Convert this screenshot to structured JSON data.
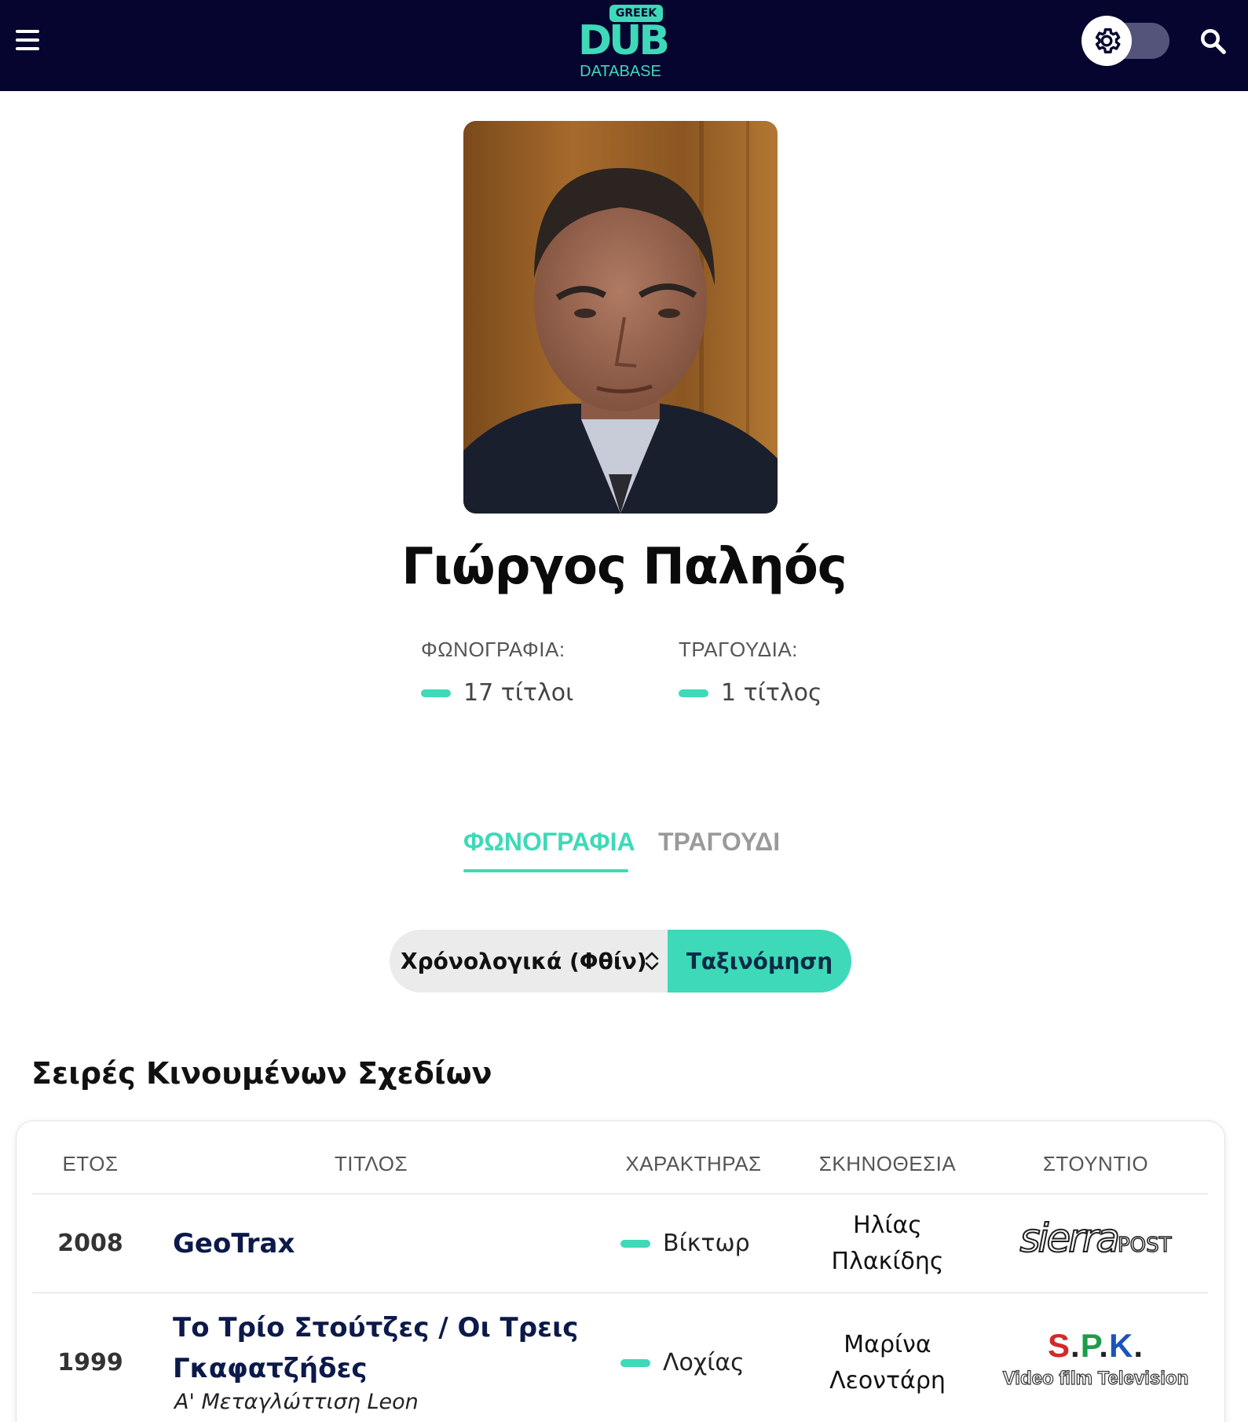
{
  "header": {
    "logo_top": "GREEK",
    "logo_main": "DUB",
    "logo_bottom": "DATABASE",
    "menu_icon": "hamburger-menu-icon",
    "settings_icon": "gear-icon",
    "search_icon": "search-icon",
    "background": "#050530",
    "accent": "#3ed9b8"
  },
  "profile": {
    "name": "Γιώργος Παληός",
    "stats": [
      {
        "label": "ΦΩΝΟΓΡΑΦΙΑ:",
        "value": "17 τίτλοι"
      },
      {
        "label": "ΤΡΑΓΟΥΔΙΑ:",
        "value": "1 τίτλος"
      }
    ]
  },
  "tabs": [
    {
      "label": "ΦΩΝΟΓΡΑΦΙΑ",
      "active": true
    },
    {
      "label": "ΤΡΑΓΟΥΔΙ",
      "active": false
    }
  ],
  "sort": {
    "selected": "Χρόνολογικά (Φθίν)",
    "button": "Ταξινόμηση"
  },
  "section": {
    "title": "Σειρές Κινουμένων Σχεδίων",
    "columns": [
      "ΕΤΟΣ",
      "ΤΙΤΛΟΣ",
      "ΧΑΡΑΚΤΗΡΑΣ",
      "ΣΚΗΝΟΘΕΣΙΑ",
      "ΣΤΟΥΝΤΙΟ"
    ],
    "rows": [
      {
        "year": "2008",
        "title": "GeoTrax",
        "subtitle": "",
        "character": "Βίκτωρ",
        "director_line1": "Ηλίας",
        "director_line2": "Πλακίδης",
        "studio_main": "sierra",
        "studio_sub": "POST"
      },
      {
        "year": "1999",
        "title_line1": "Το Τρίο Στούτζες / Οι Τρεις",
        "title_line2": "Γκαφατζήδες",
        "subtitle": "Α' Μεταγλώττιση Leon",
        "character": "Λοχίας",
        "director_line1": "Μαρίνα",
        "director_line2": "Λεοντάρη",
        "studio_main": "S.P.K.",
        "studio_sub": "Video film Television"
      }
    ]
  }
}
